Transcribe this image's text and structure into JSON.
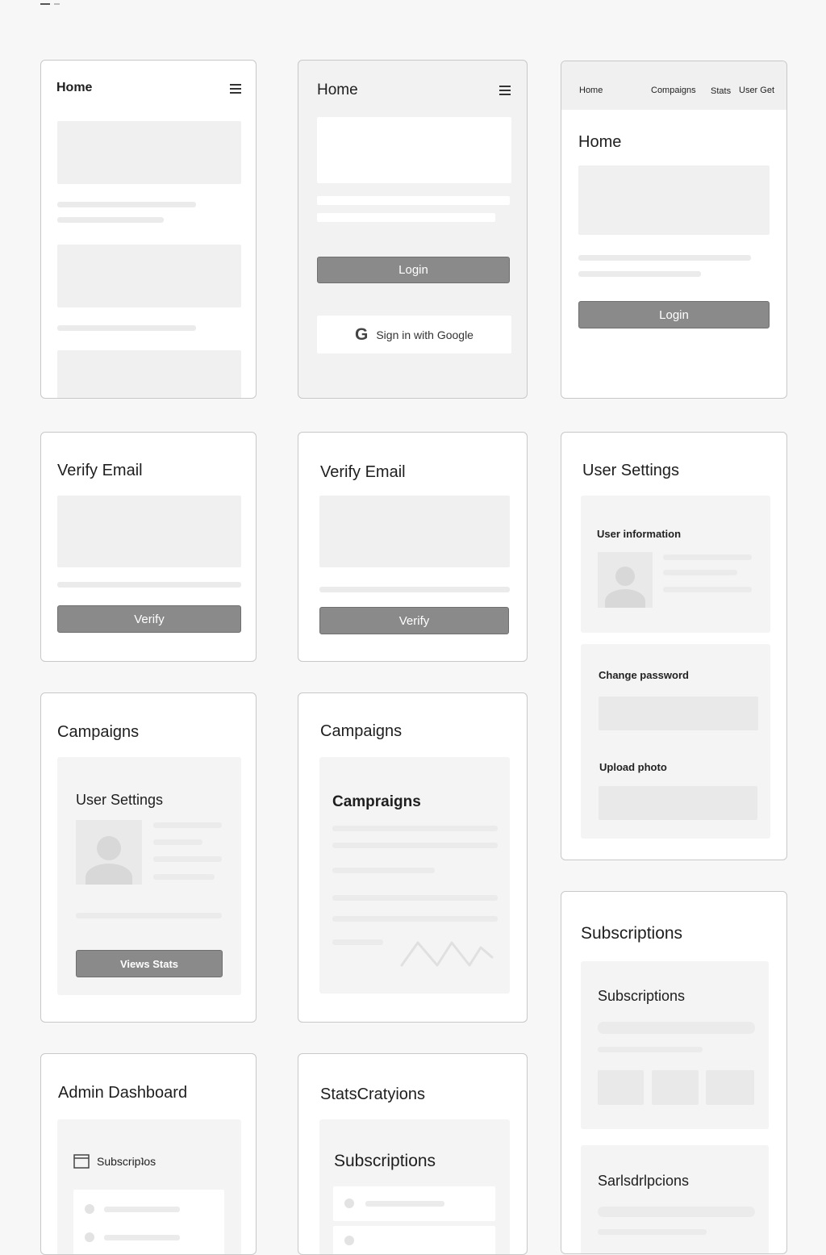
{
  "colors": {
    "button": "#8a8a8a",
    "border": "#c8c8c8",
    "placeholder": "#f0f0f0",
    "background": "#f7f7f7"
  },
  "home_mobile": {
    "title": "Home",
    "menu_icon": "hamburger-menu-icon"
  },
  "login_mobile": {
    "title": "Home",
    "menu_icon": "hamburger-menu-icon",
    "login_label": "Login",
    "google_label": "Sign in with Google",
    "google_icon": "google-g-icon"
  },
  "login_desktop": {
    "nav": [
      "Home",
      "Compaigns",
      "Stats",
      "User Get"
    ],
    "title": "Home",
    "login_label": "Login"
  },
  "verify_1": {
    "title": "Verify Email",
    "button_label": "Verify"
  },
  "verify_2": {
    "title": "Verify Email",
    "button_label": "Verify"
  },
  "user_settings": {
    "title": "User Settings",
    "info_label": "User information",
    "password_label": "Change password",
    "upload_label": "Upload photo",
    "avatar_icon": "user-avatar-icon"
  },
  "campaigns_1": {
    "title": "Campaigns",
    "panel_title": "User Settings",
    "button_label": "Views Stats",
    "avatar_icon": "user-avatar-icon"
  },
  "campaigns_2": {
    "title": "Campaigns",
    "panel_title": "Campraigns",
    "sparkline_icon": "zigzag-chart-icon"
  },
  "subscriptions": {
    "title": "Subscriptions",
    "panel_title": "Subscriptions",
    "panel2_title": "Sarlsdrlpcions"
  },
  "admin": {
    "title": "Admin Dashboard",
    "item_label": "Subscripʇos",
    "item_icon": "window-icon"
  },
  "stats": {
    "title": "StatsCratyions",
    "panel_title": "Subscriptions"
  }
}
